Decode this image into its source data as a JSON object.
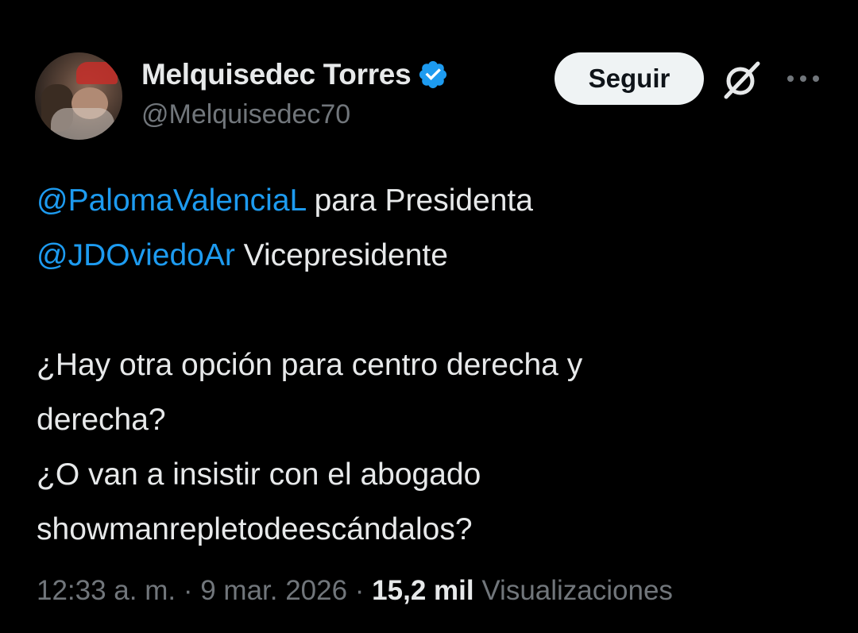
{
  "author": {
    "display_name": "Melquisedec Torres",
    "handle": "@Melquisedec70",
    "verified": true
  },
  "actions": {
    "follow_label": "Seguir",
    "grok_icon": "grok-icon",
    "more_icon": "more-icon"
  },
  "tweet": {
    "lines": [
      {
        "mention": "@PalomaValenciaL",
        "text": " para Presidenta"
      },
      {
        "mention": "@JDOviedoAr",
        "text": " Vicepresidente"
      },
      {
        "text": "¿Hay otra opción para centro derecha y"
      },
      {
        "text": "derecha?"
      },
      {
        "text": "¿O van a insistir con el abogado"
      },
      {
        "text": "showmanrepletodeescándalos?"
      }
    ]
  },
  "meta": {
    "time": "12:33 a. m.",
    "separator": " · ",
    "date": "9 mar. 2026",
    "views_count": "15,2 mil",
    "views_label": "Visualizaciones"
  },
  "colors": {
    "background": "#000000",
    "text": "#e7e9ea",
    "secondary": "#71767b",
    "accent": "#1d9bf0",
    "button_bg": "#eff3f4"
  }
}
